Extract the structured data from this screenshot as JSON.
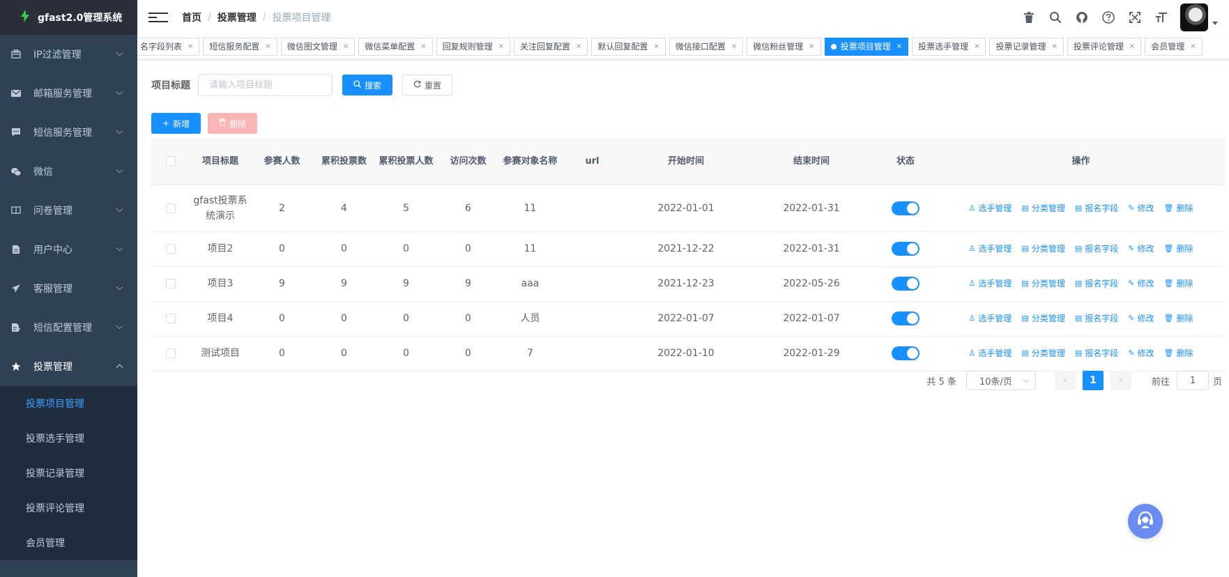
{
  "app": {
    "title": "gfast2.0管理系统"
  },
  "sidebar": {
    "items": [
      {
        "label": "IP过滤管理",
        "icon": "ip-filter-icon"
      },
      {
        "label": "邮箱服务管理",
        "icon": "email-icon"
      },
      {
        "label": "短信服务管理",
        "icon": "message-icon"
      },
      {
        "label": "微信",
        "icon": "wechat-icon"
      },
      {
        "label": "问卷管理",
        "icon": "book-icon"
      },
      {
        "label": "用户中心",
        "icon": "document-icon"
      },
      {
        "label": "客服管理",
        "icon": "send-icon"
      },
      {
        "label": "短信配置管理",
        "icon": "document-edit-icon"
      },
      {
        "label": "投票管理",
        "icon": "star-icon"
      }
    ],
    "submenu": [
      {
        "label": "投票项目管理",
        "active": true
      },
      {
        "label": "投票选手管理"
      },
      {
        "label": "投票记录管理"
      },
      {
        "label": "投票评论管理"
      },
      {
        "label": "会员管理"
      }
    ]
  },
  "header": {
    "breadcrumb": [
      "首页",
      "投票管理",
      "投票项目管理"
    ],
    "separator": "/",
    "icons": [
      "trash-icon",
      "search-icon",
      "github-icon",
      "help-icon",
      "fullscreen-icon",
      "font-size-icon"
    ]
  },
  "tags": [
    "名字段列表",
    "短信服务配置",
    "微信图文管理",
    "微信菜单配置",
    "回复规则管理",
    "关注回复配置",
    "默认回复配置",
    "微信接口配置",
    "微信粉丝管理",
    "投票项目管理",
    "投票选手管理",
    "投票记录管理",
    "投票评论管理",
    "会员管理"
  ],
  "active_tag": "投票项目管理",
  "search": {
    "label": "项目标题",
    "placeholder": "请输入项目标题",
    "search_label": "搜索",
    "reset_label": "重置"
  },
  "toolbar": {
    "add_label": "新增",
    "delete_label": "删除"
  },
  "table": {
    "columns": [
      "项目标题",
      "参赛人数",
      "累积投票数",
      "累积投票人数",
      "访问次数",
      "参赛对象名称",
      "url",
      "开始时间",
      "结束时间",
      "状态",
      "操作"
    ],
    "rows": [
      {
        "title": "gfast投票系统演示",
        "players": "2",
        "votes": "4",
        "voters": "5",
        "visits": "6",
        "target": "11",
        "url": "",
        "start": "2022-01-01",
        "end": "2022-01-31",
        "status": true
      },
      {
        "title": "项目2",
        "players": "0",
        "votes": "0",
        "voters": "0",
        "visits": "0",
        "target": "11",
        "url": "",
        "start": "2021-12-22",
        "end": "2022-01-31",
        "status": true
      },
      {
        "title": "项目3",
        "players": "9",
        "votes": "9",
        "voters": "9",
        "visits": "9",
        "target": "aaa",
        "url": "",
        "start": "2021-12-23",
        "end": "2022-05-26",
        "status": true
      },
      {
        "title": "项目4",
        "players": "0",
        "votes": "0",
        "voters": "0",
        "visits": "0",
        "target": "人员",
        "url": "",
        "start": "2022-01-07",
        "end": "2022-01-07",
        "status": true
      },
      {
        "title": "测试项目",
        "players": "0",
        "votes": "0",
        "voters": "0",
        "visits": "0",
        "target": "7",
        "url": "",
        "start": "2022-01-10",
        "end": "2022-01-29",
        "status": true
      }
    ],
    "ops": [
      "选手管理",
      "分类管理",
      "报名字段",
      "修改",
      "删除"
    ]
  },
  "pagination": {
    "total_text": "共 5 条",
    "page_size": "10条/页",
    "current_page": "1",
    "goto_prefix": "前往",
    "goto_value": "1",
    "goto_suffix": "页"
  },
  "colors": {
    "primary": "#1890ff",
    "sidebar_bg": "#304156",
    "submenu_bg": "#1f2d3d",
    "danger_light": "#fab6b6"
  }
}
